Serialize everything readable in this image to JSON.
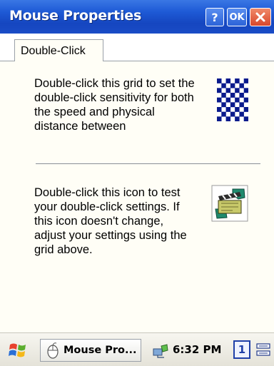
{
  "window": {
    "title": "Mouse Properties",
    "help_label": "?",
    "ok_label": "OK"
  },
  "tabs": [
    {
      "label": "Double-Click"
    }
  ],
  "content": {
    "grid_text": "Double-click this grid to set the double-click sensitivity for both the speed and physical distance between",
    "test_text": "Double-click this icon to test your double-click settings. If this icon doesn't change, adjust your settings using the grid above."
  },
  "taskbar": {
    "task_label": "Mouse Pro...",
    "time": "6:32 PM",
    "input_indicator": "1"
  },
  "colors": {
    "titlebar": "#1e5ad6",
    "grid_checker": "#0a1a8c",
    "close_button": "#d9472b"
  }
}
